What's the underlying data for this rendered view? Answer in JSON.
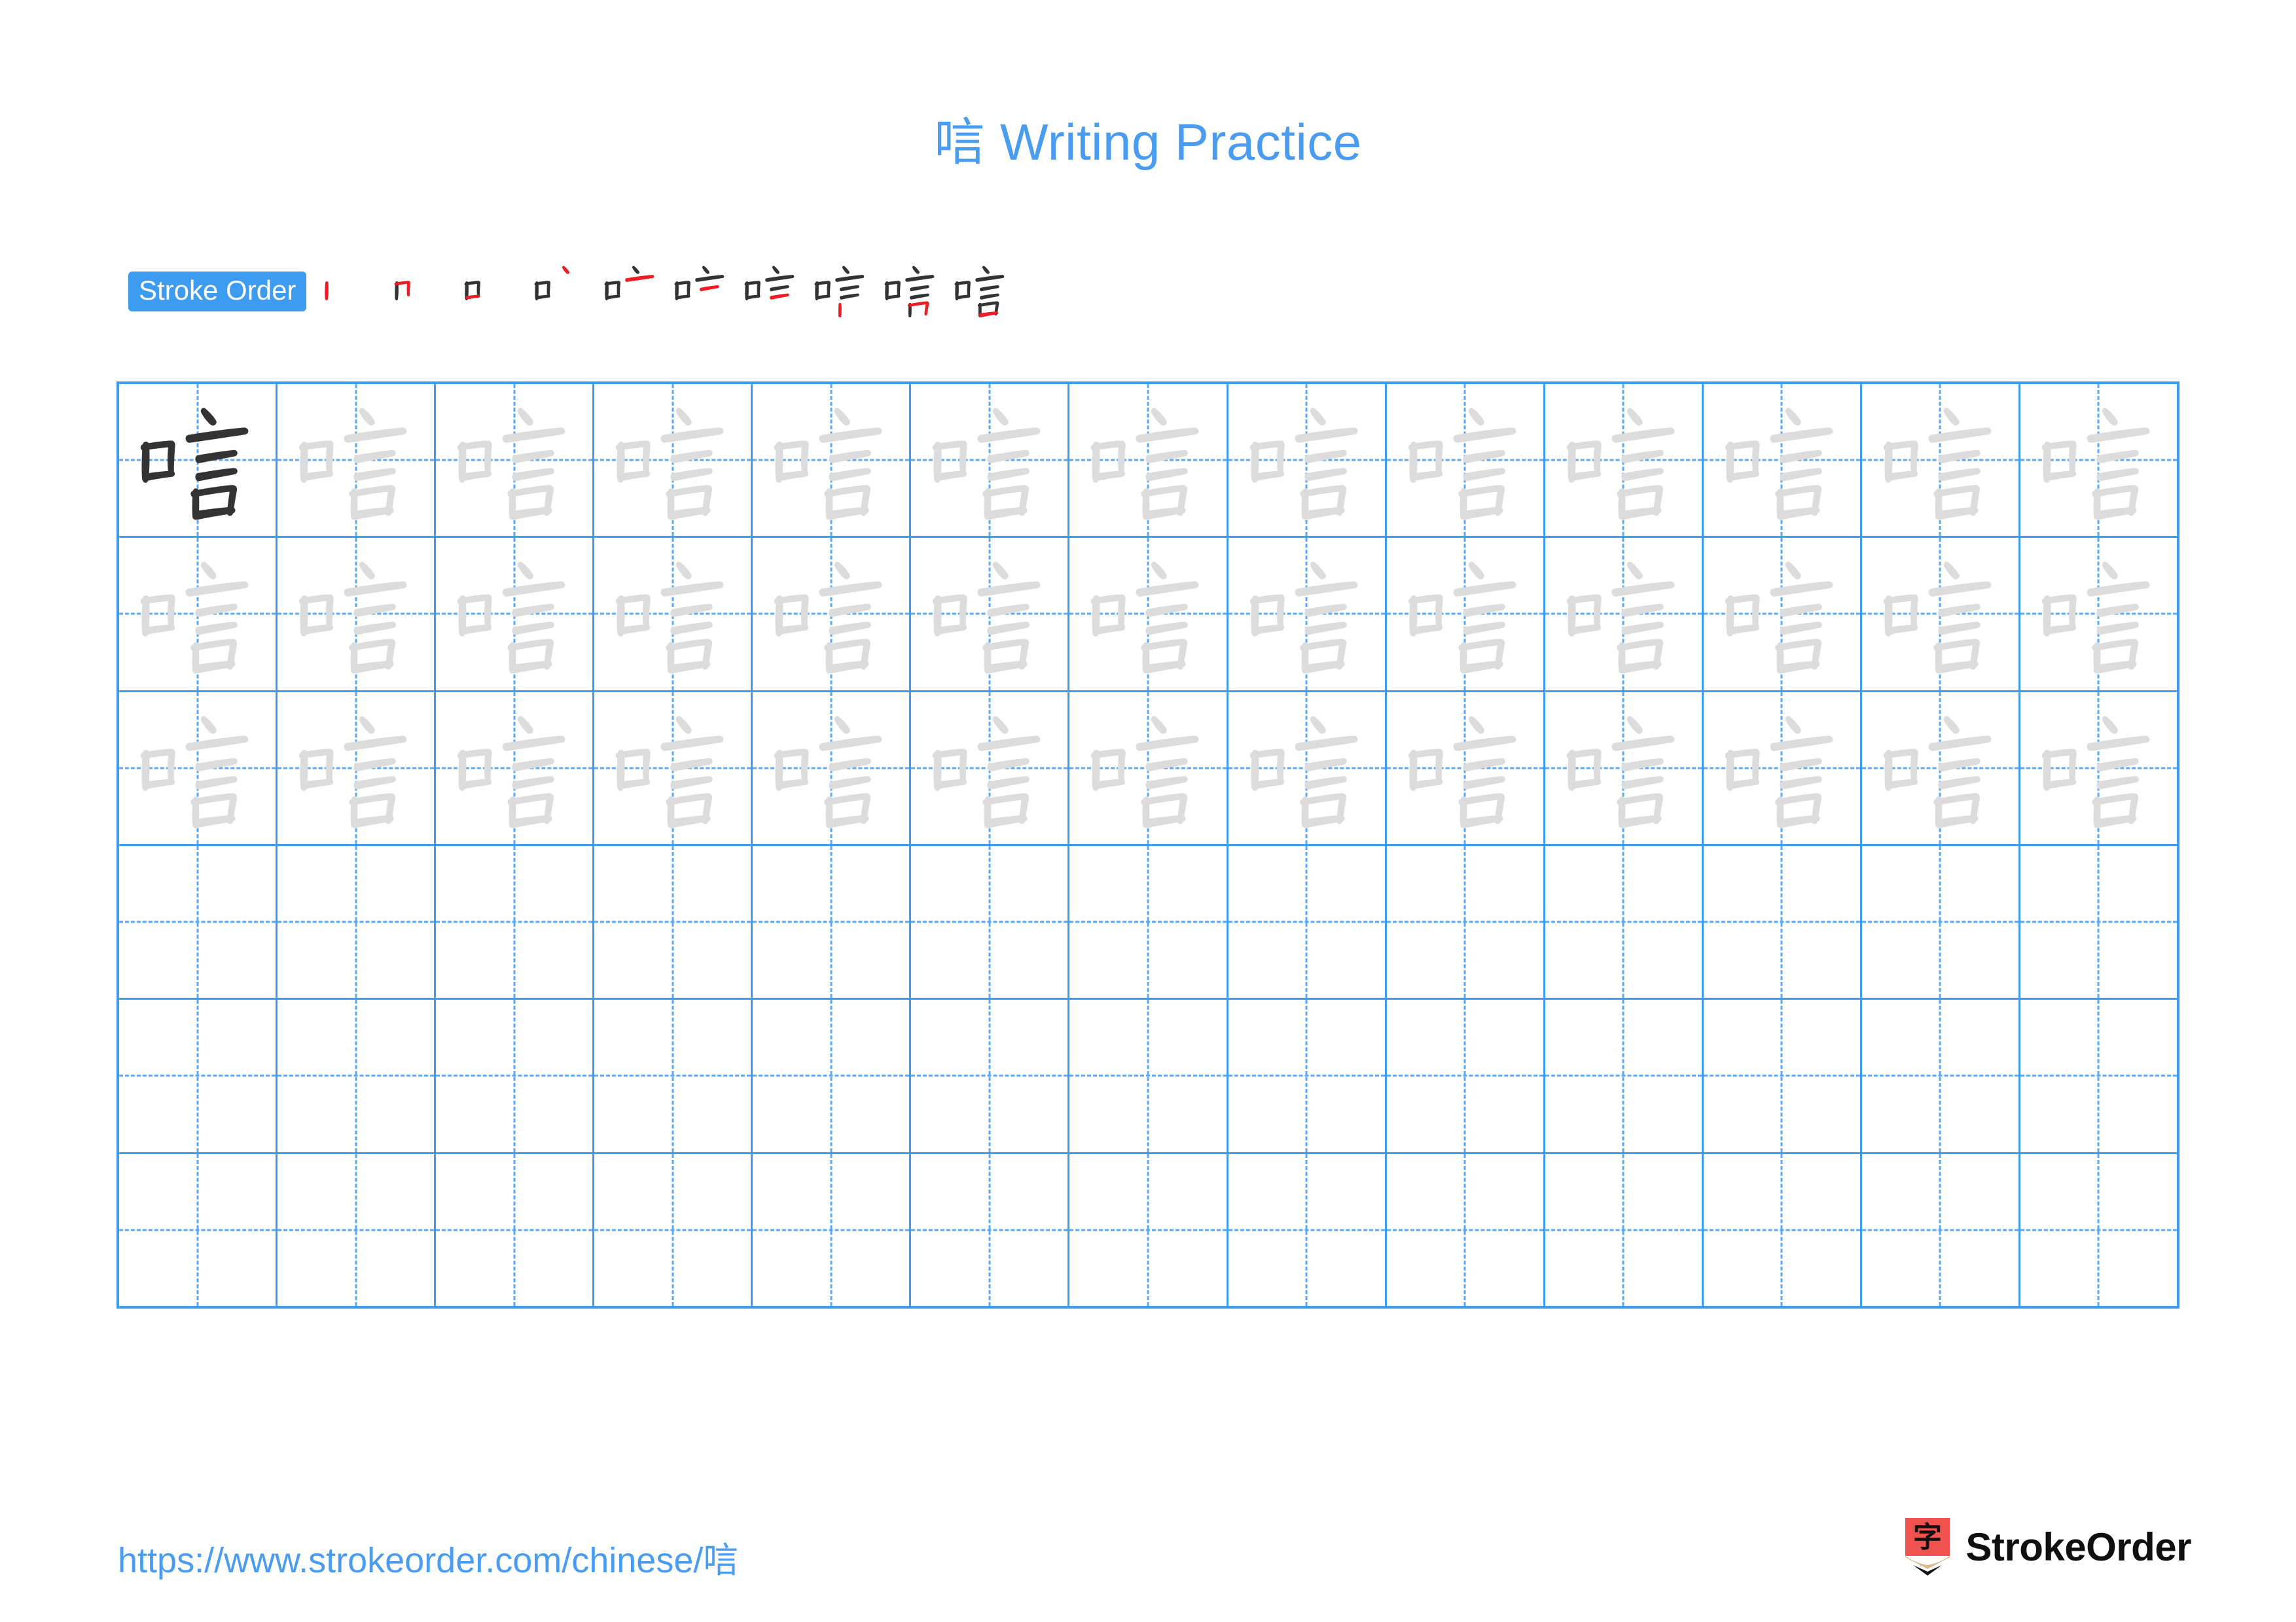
{
  "document": {
    "character": "唁",
    "title": "唁 Writing Practice",
    "title_suffix": " Writing Practice"
  },
  "colors": {
    "accent_blue": "#3d9bf0",
    "title_blue": "#4a9cf0",
    "guide_blue": "#5aa9f5",
    "ink_black": "#333333",
    "trace_gray": "#dcdcdc",
    "highlight_red": "#ee1c25",
    "logo_red": "#f0534f",
    "logo_wood": "#dbb992"
  },
  "stroke_order": {
    "label": "Stroke Order",
    "total_strokes": 10,
    "steps": [
      {
        "index": 1,
        "stroke_count": 1,
        "new_stroke": "丨 vertical (left of 口)"
      },
      {
        "index": 2,
        "stroke_count": 2,
        "new_stroke": "𠃍 horizontal-turn (top-right of 口)"
      },
      {
        "index": 3,
        "stroke_count": 3,
        "new_stroke": "一 bottom horizontal (closes 口)"
      },
      {
        "index": 4,
        "stroke_count": 4,
        "new_stroke": "丶 dot (top of 言)"
      },
      {
        "index": 5,
        "stroke_count": 5,
        "new_stroke": "一 long top horizontal of 言"
      },
      {
        "index": 6,
        "stroke_count": 6,
        "new_stroke": "一 second horizontal of 言"
      },
      {
        "index": 7,
        "stroke_count": 7,
        "new_stroke": "一 third horizontal of 言"
      },
      {
        "index": 8,
        "stroke_count": 8,
        "new_stroke": "丨 left vertical of 口 in 言"
      },
      {
        "index": 9,
        "stroke_count": 9,
        "new_stroke": "𠃍 horizontal-turn of 口 in 言"
      },
      {
        "index": 10,
        "stroke_count": 10,
        "new_stroke": "一 bottom horizontal of 口 in 言"
      }
    ]
  },
  "grid": {
    "columns": 13,
    "rows": 6,
    "row_styles": [
      "first-ink-then-trace",
      "trace",
      "trace",
      "empty",
      "empty",
      "empty"
    ]
  },
  "footer": {
    "url": "https://www.strokeorder.com/chinese/唁",
    "brand_name": "StrokeOrder",
    "brand_mark_char": "字"
  }
}
